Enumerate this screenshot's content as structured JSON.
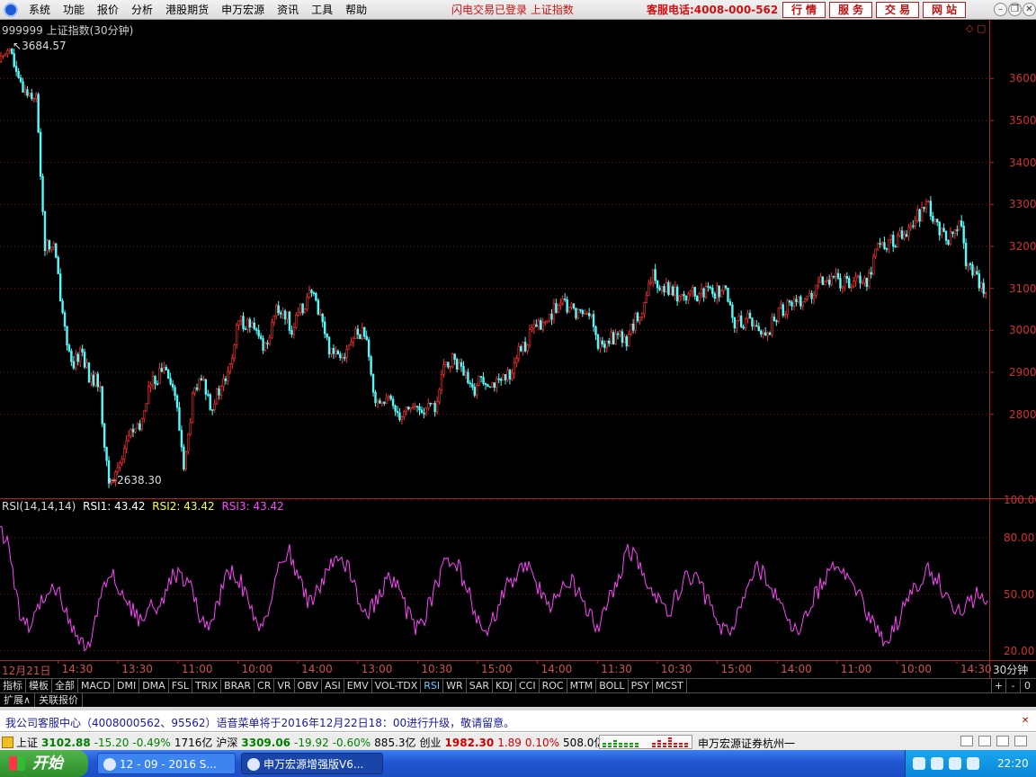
{
  "menubar": {
    "items": [
      "系统",
      "功能",
      "报价",
      "分析",
      "港股期货",
      "申万宏源",
      "资讯",
      "工具",
      "帮助"
    ],
    "login_status": "闪电交易已登录   上证指数",
    "hotline": "客服电话:4008-000-562",
    "buttons": [
      "行情",
      "服务",
      "交易",
      "网站"
    ]
  },
  "chart": {
    "title": "999999 上证指数(30分钟)",
    "high_label": "3684.57",
    "low_label": "2638.30",
    "period": "30分钟",
    "rsi_legend": {
      "name": "RSI(14,14,14)",
      "rsi1": "RSI1: 43.42",
      "rsi2": "RSI2: 43.42",
      "rsi3": "RSI3: 43.42"
    }
  },
  "chart_data": [
    {
      "type": "candlestick",
      "title": "999999 上证指数(30分钟)",
      "y_ticks": [
        2800,
        2900,
        3000,
        3100,
        3200,
        3300,
        3400,
        3500,
        3600
      ],
      "ylim": [
        2600,
        3740
      ],
      "x_ticks": [
        "12月21日",
        "14:30",
        "13:30",
        "11:00",
        "10:00",
        "14:00",
        "13:00",
        "10:30",
        "15:00",
        "14:00",
        "11:30",
        "10:30",
        "15:00",
        "14:00",
        "11:00",
        "10:00",
        "14:30"
      ],
      "close_path": [
        [
          0,
          3640
        ],
        [
          10,
          3684.57
        ],
        [
          20,
          3590
        ],
        [
          30,
          3570
        ],
        [
          40,
          3560
        ],
        [
          50,
          3200
        ],
        [
          60,
          3200
        ],
        [
          70,
          3040
        ],
        [
          80,
          2900
        ],
        [
          90,
          2960
        ],
        [
          100,
          2880
        ],
        [
          110,
          2880
        ],
        [
          120,
          2640
        ],
        [
          125,
          2638.3
        ],
        [
          135,
          2700
        ],
        [
          145,
          2760
        ],
        [
          155,
          2760
        ],
        [
          165,
          2860
        ],
        [
          175,
          2890
        ],
        [
          185,
          2920
        ],
        [
          195,
          2840
        ],
        [
          205,
          2670
        ],
        [
          215,
          2850
        ],
        [
          225,
          2880
        ],
        [
          235,
          2820
        ],
        [
          245,
          2860
        ],
        [
          255,
          2900
        ],
        [
          265,
          3020
        ],
        [
          275,
          3020
        ],
        [
          285,
          2990
        ],
        [
          295,
          2960
        ],
        [
          305,
          3040
        ],
        [
          315,
          3050
        ],
        [
          325,
          3000
        ],
        [
          335,
          3050
        ],
        [
          345,
          3090
        ],
        [
          355,
          3050
        ],
        [
          365,
          2960
        ],
        [
          375,
          2950
        ],
        [
          385,
          2950
        ],
        [
          395,
          2990
        ],
        [
          405,
          3000
        ],
        [
          415,
          2850
        ],
        [
          425,
          2830
        ],
        [
          435,
          2830
        ],
        [
          445,
          2800
        ],
        [
          455,
          2820
        ],
        [
          465,
          2810
        ],
        [
          475,
          2810
        ],
        [
          485,
          2820
        ],
        [
          495,
          2920
        ],
        [
          505,
          2930
        ],
        [
          515,
          2900
        ],
        [
          525,
          2850
        ],
        [
          535,
          2890
        ],
        [
          545,
          2880
        ],
        [
          555,
          2870
        ],
        [
          565,
          2890
        ],
        [
          575,
          2940
        ],
        [
          585,
          2970
        ],
        [
          595,
          3010
        ],
        [
          605,
          3010
        ],
        [
          615,
          3050
        ],
        [
          625,
          3060
        ],
        [
          635,
          3050
        ],
        [
          645,
          3040
        ],
        [
          655,
          3050
        ],
        [
          665,
          2960
        ],
        [
          675,
          2970
        ],
        [
          685,
          2990
        ],
        [
          695,
          2970
        ],
        [
          705,
          3020
        ],
        [
          715,
          3040
        ],
        [
          725,
          3130
        ],
        [
          735,
          3110
        ],
        [
          745,
          3100
        ],
        [
          755,
          3080
        ],
        [
          765,
          3090
        ],
        [
          775,
          3080
        ],
        [
          785,
          3090
        ],
        [
          795,
          3090
        ],
        [
          805,
          3100
        ],
        [
          815,
          3020
        ],
        [
          825,
          3020
        ],
        [
          835,
          3030
        ],
        [
          845,
          2990
        ],
        [
          855,
          3000
        ],
        [
          865,
          3040
        ],
        [
          875,
          3060
        ],
        [
          885,
          3070
        ],
        [
          895,
          3080
        ],
        [
          905,
          3080
        ],
        [
          915,
          3120
        ],
        [
          925,
          3130
        ],
        [
          935,
          3110
        ],
        [
          945,
          3120
        ],
        [
          955,
          3130
        ],
        [
          965,
          3120
        ],
        [
          975,
          3200
        ],
        [
          985,
          3210
        ],
        [
          995,
          3210
        ],
        [
          1005,
          3230
        ],
        [
          1015,
          3260
        ],
        [
          1025,
          3280
        ],
        [
          1030,
          3300
        ],
        [
          1040,
          3260
        ],
        [
          1050,
          3220
        ],
        [
          1060,
          3220
        ],
        [
          1068,
          3250
        ],
        [
          1075,
          3160
        ],
        [
          1085,
          3120
        ],
        [
          1095,
          3100
        ]
      ]
    },
    {
      "type": "line",
      "title": "RSI(14,14,14)",
      "series": [
        {
          "name": "RSI3",
          "color": "#ff44ff"
        }
      ],
      "y_ticks": [
        20,
        50,
        80,
        100
      ],
      "ylim": [
        15,
        100
      ],
      "pattern": [
        86,
        72,
        40,
        30,
        45,
        52,
        50,
        36,
        24,
        22,
        48,
        62,
        54,
        44,
        36,
        46,
        40,
        58,
        60,
        55,
        40,
        34,
        48,
        62,
        58,
        44,
        30,
        42,
        64,
        72,
        58,
        44,
        52,
        66,
        70,
        62,
        46,
        40,
        50,
        58,
        52,
        38,
        30,
        44,
        58,
        70,
        64,
        50,
        36,
        30,
        44,
        56,
        62,
        66,
        54,
        44,
        48,
        58,
        52,
        40,
        32,
        46,
        58,
        74,
        66,
        54,
        46,
        40,
        52,
        60,
        56,
        46,
        36,
        28,
        42,
        56,
        64,
        58,
        48,
        38,
        30,
        42,
        52,
        60,
        68,
        60,
        50,
        40,
        32,
        24,
        36,
        48,
        56,
        62,
        58,
        48,
        40,
        44,
        50,
        46
      ]
    }
  ],
  "indicators": {
    "tabs": [
      "指标",
      "模板",
      "全部",
      "MACD",
      "DMI",
      "DMA",
      "FSL",
      "TRIX",
      "BRAR",
      "CR",
      "VR",
      "OBV",
      "ASI",
      "EMV",
      "VOL-TDX",
      "RSI",
      "WR",
      "SAR",
      "KDJ",
      "CCI",
      "ROC",
      "MTM",
      "BOLL",
      "PSY",
      "MCST"
    ],
    "active": "RSI",
    "plus": "+",
    "minus": "-",
    "zero": "0"
  },
  "subtabs": [
    "扩展∧",
    "关联报价"
  ],
  "announcement": "我公司客服中心（4008000562、95562）语音菜单将于2016年12月22日18：00进行升级，敬请留意。",
  "ticker": {
    "sh_label": "上证",
    "sh_value": "3102.88",
    "sh_change": "-15.20",
    "sh_pct": "-0.49%",
    "sh_amount": "1716亿",
    "hs_label": "沪深",
    "hs_value": "3309.06",
    "hs_change": "-19.92",
    "hs_pct": "-0.60%",
    "hs_amount": "885.3亿",
    "cy_label": "创业",
    "cy_value": "1982.30",
    "cy_change": "1.89",
    "cy_pct": "0.10%",
    "cy_amount": "508.0亿",
    "broker": "申万宏源证券杭州一"
  },
  "taskbar": {
    "start": "开始",
    "task1": "12 - 09 - 2016 S...",
    "task2": "申万宏源增强版V6...",
    "clock": "22:20"
  }
}
